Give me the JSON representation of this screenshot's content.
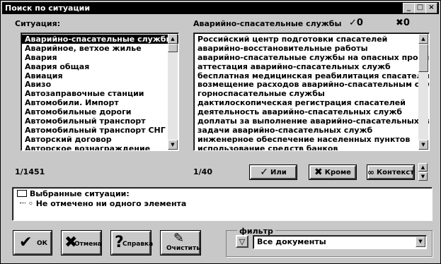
{
  "window": {
    "title": "Поиск по ситуации"
  },
  "titlebar_buttons": [
    "_",
    "□",
    "×"
  ],
  "situations": {
    "label": "Ситуация:",
    "items": [
      "Аварийно-спасательные службы",
      "Аварийное, ветхое жилье",
      "Авария",
      "Авария общая",
      "Авиация",
      "Авизо",
      "Автозаправочные станции",
      "Автомобили. Импорт",
      "Автомобильные дороги",
      "Автомобильный транспорт",
      "Автомобильный транспорт СНГ",
      "Авторский договор",
      "Авторское вознаграждение"
    ],
    "selected_index": 0,
    "counter": "1/1451"
  },
  "subsituations": {
    "label": "Аварийно-спасательные службы",
    "check_count": "0",
    "cross_count": "0",
    "items": [
      "Российский центр подготовки спасателей",
      "аварийно-восстановительные работы",
      "аварийно-спасательные службы на опасных произв",
      "аттестация аварийно-спасательных служб",
      "бесплатная медицинская реабилитация спасателей",
      "возмещение расходов аварийно-спасательным слу",
      "горноспасательные службы",
      "дактилоскопическая регистрация спасателей",
      "деятельность аварийно-спасательных служб",
      "доплаты за выполнение аварийно-спасательных ра",
      "задачи аварийно-спасательных служб",
      "инженерное обеспечение населенных пунктов",
      "использование средств банков"
    ],
    "counter": "1/40"
  },
  "buttons": {
    "or": "Или",
    "except": "Кроме",
    "context": "Контекст",
    "ok": "ОК",
    "cancel": "Отмена",
    "help": "Справка",
    "clear": "Очистить"
  },
  "selected": {
    "header": "Выбранные ситуации:",
    "empty": "Не отмечено ни одного элемента"
  },
  "filter": {
    "label": "фильтр",
    "value": "Все документы"
  }
}
